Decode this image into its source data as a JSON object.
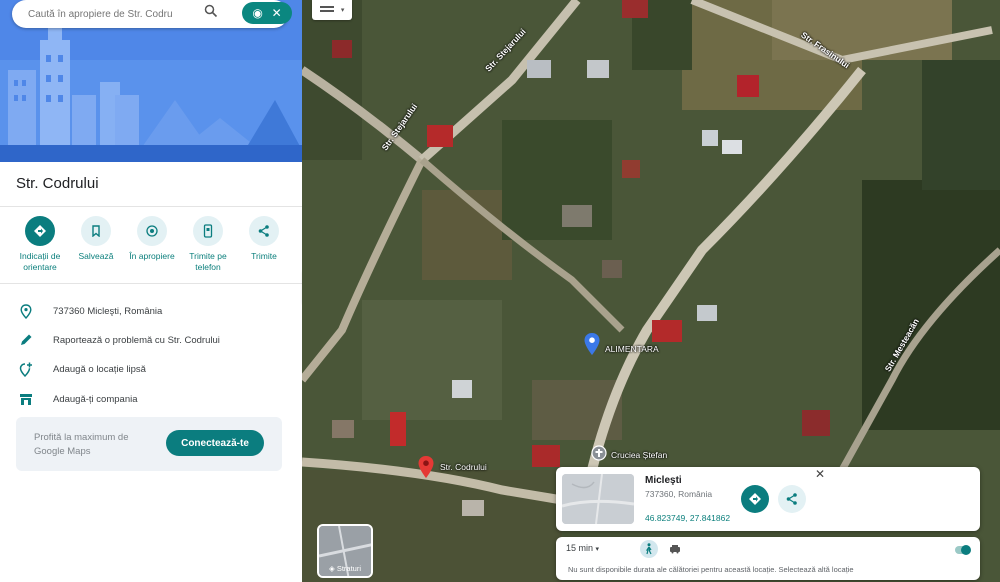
{
  "search": {
    "placeholder": "Caută în apropiere de Str. Codru"
  },
  "place": {
    "title": "Str. Codrului"
  },
  "actions": [
    {
      "label": "Indicații de orientare"
    },
    {
      "label": "Salvează"
    },
    {
      "label": "În apropiere"
    },
    {
      "label": "Trimite pe telefon"
    },
    {
      "label": "Trimite"
    }
  ],
  "info": {
    "address": "737360 Micleşti, România",
    "report": "Raportează o problemă cu Str. Codrului",
    "add_place": "Adaugă o locație lipsă",
    "add_business": "Adaugă-ți compania"
  },
  "promo": {
    "text": "Profită la maximum de Google Maps",
    "button": "Conectează-te"
  },
  "map": {
    "streets": [
      "Str. Stejarului",
      "Str. Stejarului",
      "Str. Frasinului",
      "Str. Mesteacăn",
      "Str. Codrului"
    ],
    "markers": {
      "red_pin_label": "Str. Codrului",
      "blue_pin_label": "ALIMENTARA",
      "grey_pin_label": "Cruciea Ștefan"
    },
    "layers_label": "Straturi"
  },
  "card": {
    "name": "Micleşti",
    "subtitle": "737360, România",
    "coords": "46.823749, 27.841862"
  },
  "travel": {
    "time": "15 min",
    "message": "Nu sunt disponibile durata ale călătoriei pentru această locație. Selectează altă locație"
  },
  "colors": {
    "accent": "#0b7d7f",
    "hero": "#4f87e8",
    "pin_red": "#e53935",
    "pin_blue": "#3b78e7"
  }
}
